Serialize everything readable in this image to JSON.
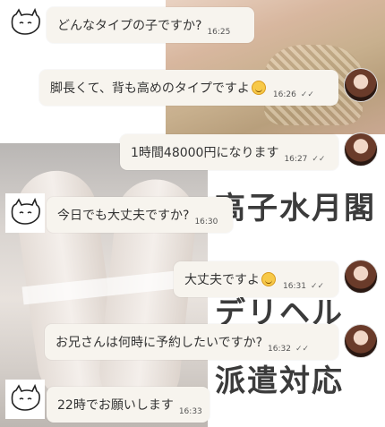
{
  "overlay": {
    "line1": "高子水月閣",
    "line2": "デリヘル",
    "line3": "派遣対応"
  },
  "messages": [
    {
      "text": "どんなタイプの子ですか?",
      "time": "16:25",
      "side": "left"
    },
    {
      "text": "脚長くて、背も高めのタイプですよ",
      "emoji": "smile-emoji",
      "time": "16:26",
      "side": "right",
      "read": "✓✓"
    },
    {
      "text": "1時間48000円になります",
      "time": "16:27",
      "side": "right",
      "read": "✓✓"
    },
    {
      "text": "今日でも大丈夫ですか?",
      "time": "16:30",
      "side": "left"
    },
    {
      "text": "大丈夫ですよ",
      "emoji": "smile-emoji",
      "time": "16:31",
      "side": "right",
      "read": "✓✓"
    },
    {
      "text": "お兄さんは何時に予約したいですか?",
      "time": "16:32",
      "side": "right",
      "read": "✓✓"
    },
    {
      "text": "22時でお願いします",
      "time": "16:33",
      "side": "left"
    }
  ]
}
